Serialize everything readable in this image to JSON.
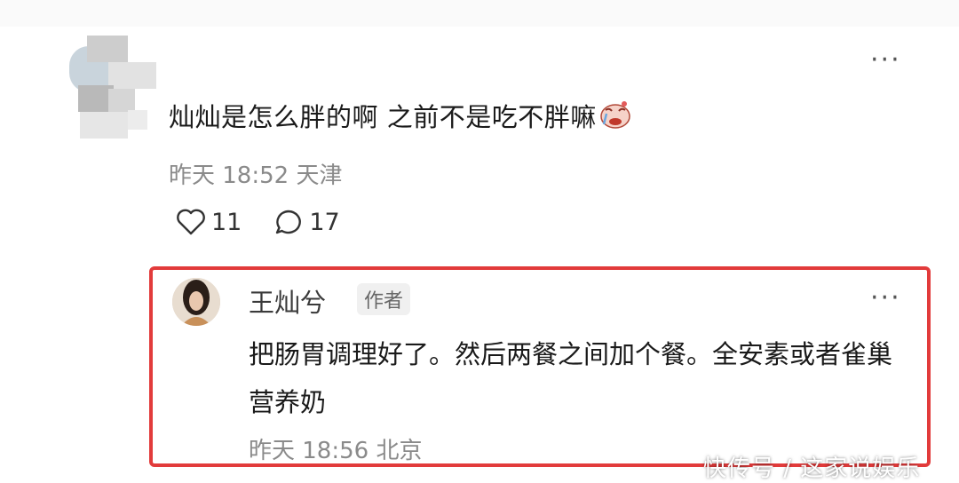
{
  "comment": {
    "text": "灿灿是怎么胖的啊 之前不是吃不胖嘛",
    "time": "昨天 18:52",
    "location": "天津",
    "likes": "11",
    "replies": "17",
    "more": "···",
    "emoji": "crying-face"
  },
  "reply": {
    "name": "王灿兮",
    "badge": "作者",
    "text": "把肠胃调理好了。然后两餐之间加个餐。全安素或者雀巢营养奶",
    "time": "昨天 18:56",
    "location": "北京",
    "more": "···",
    "highlight_color": "#e23b3b"
  },
  "watermark": "快传号 / 这家说娱乐"
}
